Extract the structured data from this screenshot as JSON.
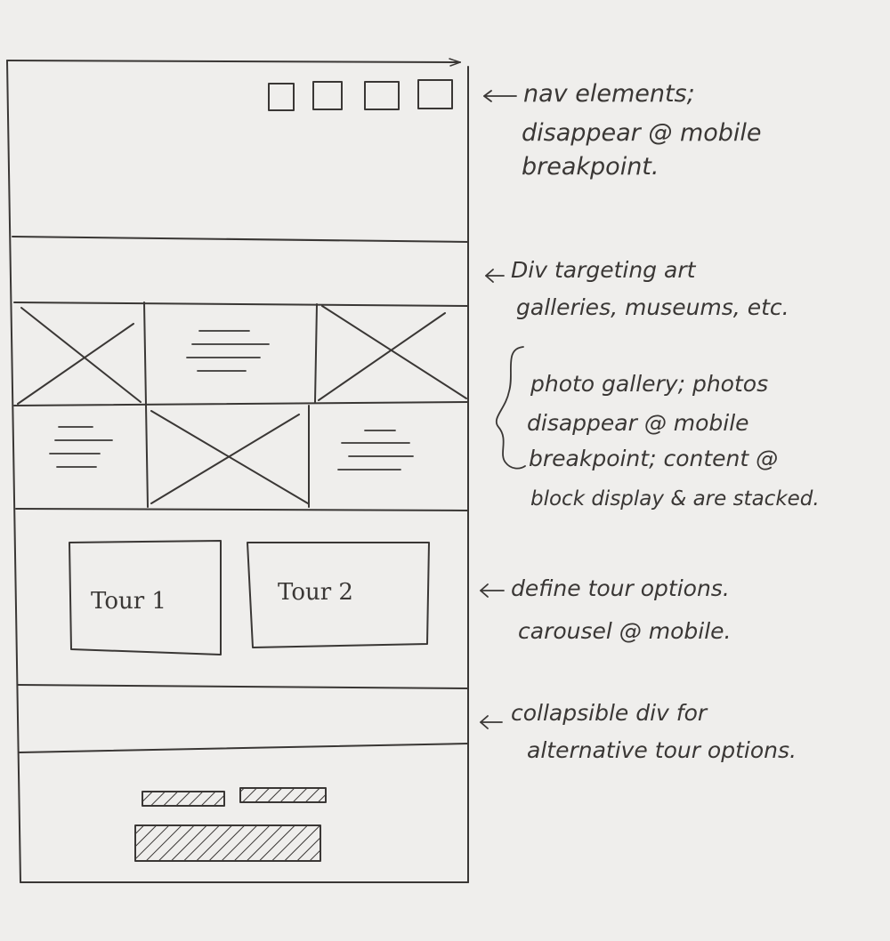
{
  "wireframe": {
    "nav_count": 4,
    "tours": [
      "Tour 1",
      "Tour 2"
    ],
    "footer_small_bars": 2,
    "footer_large_bars": 1
  },
  "annotations": {
    "nav": [
      "nav elements;",
      "disappear @ mobile",
      "breakpoint."
    ],
    "div": [
      "Div targeting art",
      "galleries, museums, etc."
    ],
    "gallery": [
      "photo gallery; photos",
      "disappear @ mobile",
      "breakpoint; content @",
      "block display & are stacked."
    ],
    "tours": [
      "define tour options.",
      "carousel @ mobile."
    ],
    "collapsible": [
      "collapsible div for",
      "alternative tour options."
    ]
  },
  "colors": {
    "paper": "#efeeec",
    "ink": "#3a3735"
  }
}
